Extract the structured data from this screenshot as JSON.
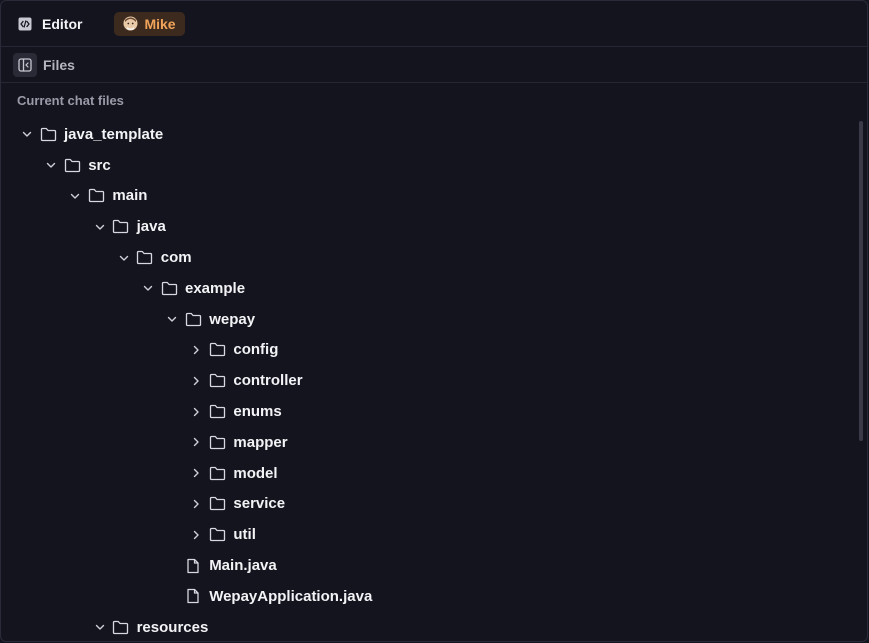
{
  "topbar": {
    "editor_label": "Editor",
    "user_name": "Mike"
  },
  "files_panel": {
    "title": "Files",
    "section_label": "Current chat files"
  },
  "tree": [
    {
      "label": "java_template",
      "type": "folder",
      "depth": 0,
      "expanded": true
    },
    {
      "label": "src",
      "type": "folder",
      "depth": 1,
      "expanded": true
    },
    {
      "label": "main",
      "type": "folder",
      "depth": 2,
      "expanded": true
    },
    {
      "label": "java",
      "type": "folder",
      "depth": 3,
      "expanded": true
    },
    {
      "label": "com",
      "type": "folder",
      "depth": 4,
      "expanded": true
    },
    {
      "label": "example",
      "type": "folder",
      "depth": 5,
      "expanded": true
    },
    {
      "label": "wepay",
      "type": "folder",
      "depth": 6,
      "expanded": true
    },
    {
      "label": "config",
      "type": "folder",
      "depth": 7,
      "expanded": false
    },
    {
      "label": "controller",
      "type": "folder",
      "depth": 7,
      "expanded": false
    },
    {
      "label": "enums",
      "type": "folder",
      "depth": 7,
      "expanded": false
    },
    {
      "label": "mapper",
      "type": "folder",
      "depth": 7,
      "expanded": false
    },
    {
      "label": "model",
      "type": "folder",
      "depth": 7,
      "expanded": false
    },
    {
      "label": "service",
      "type": "folder",
      "depth": 7,
      "expanded": false
    },
    {
      "label": "util",
      "type": "folder",
      "depth": 7,
      "expanded": false
    },
    {
      "label": "Main.java",
      "type": "file",
      "depth": 6
    },
    {
      "label": "WepayApplication.java",
      "type": "file",
      "depth": 6
    },
    {
      "label": "resources",
      "type": "folder",
      "depth": 3,
      "expanded": true
    }
  ],
  "colors": {
    "background": "#14141f",
    "badge_bg": "#3d2a1e",
    "badge_text": "#f0a45a"
  }
}
